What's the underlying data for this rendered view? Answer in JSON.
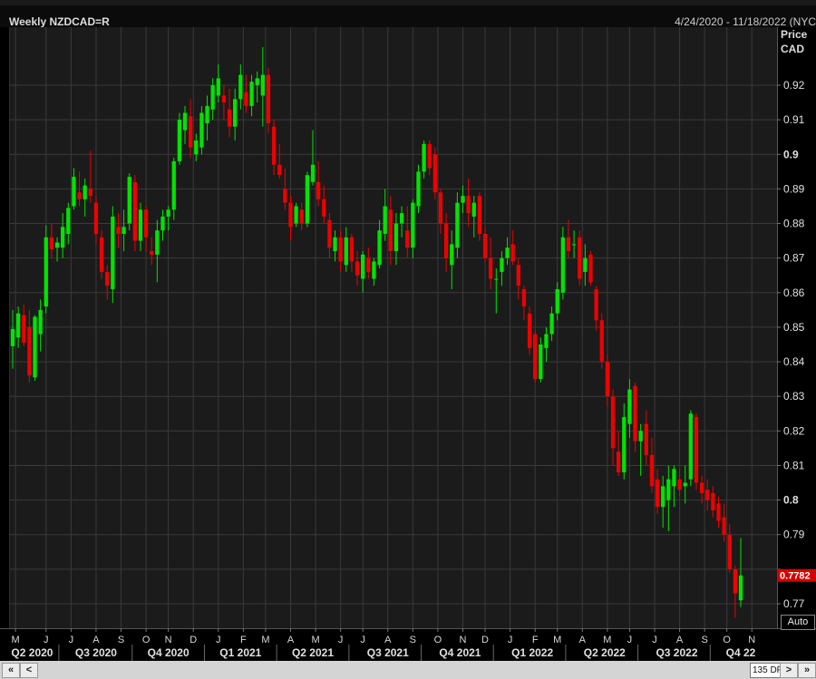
{
  "header": {
    "title": "Weekly NZDCAD=R",
    "date_range": "4/24/2020 - 11/18/2022 (NYC"
  },
  "axis": {
    "ylabel_line1": "Price",
    "ylabel_line2": "CAD",
    "auto_label": "Auto",
    "last_price_label": "0.7782"
  },
  "scrollbar": {
    "left_double": "«",
    "left_single": "<",
    "dp_label": "135 DP",
    "right_single": ">",
    "right_double": "»"
  },
  "colors": {
    "up": "#00e400",
    "down": "#ee0000",
    "bg": "#1b1b1b",
    "grid": "#3a3a3a",
    "price_tag": "#d40000"
  },
  "chart_data": {
    "type": "candlestick",
    "title": "Weekly NZDCAD=R",
    "ylabel": "Price CAD",
    "ylim": [
      0.766,
      0.934
    ],
    "y_ticks": [
      0.77,
      0.78,
      0.79,
      0.8,
      0.81,
      0.82,
      0.83,
      0.84,
      0.85,
      0.86,
      0.87,
      0.88,
      0.89,
      0.9,
      0.91,
      0.92
    ],
    "y_tick_labels": [
      "0.77",
      "",
      "0.79",
      "0.8",
      "0.81",
      "0.82",
      "0.83",
      "0.84",
      "0.85",
      "0.86",
      "0.87",
      "0.88",
      "0.89",
      "0.9",
      "0.91",
      "0.92"
    ],
    "bold_ticks": [
      0.8,
      0.9
    ],
    "month_labels": [
      {
        "label": "M",
        "week": 0.5
      },
      {
        "label": "J",
        "week": 6
      },
      {
        "label": "J",
        "week": 10.5
      },
      {
        "label": "A",
        "week": 15
      },
      {
        "label": "S",
        "week": 19.5
      },
      {
        "label": "O",
        "week": 24
      },
      {
        "label": "N",
        "week": 28
      },
      {
        "label": "D",
        "week": 32.5
      },
      {
        "label": "J",
        "week": 37
      },
      {
        "label": "F",
        "week": 41.5
      },
      {
        "label": "M",
        "week": 45.5
      },
      {
        "label": "A",
        "week": 50
      },
      {
        "label": "M",
        "week": 54.5
      },
      {
        "label": "J",
        "week": 59
      },
      {
        "label": "J",
        "week": 63
      },
      {
        "label": "A",
        "week": 67.5
      },
      {
        "label": "S",
        "week": 72
      },
      {
        "label": "O",
        "week": 76.5
      },
      {
        "label": "N",
        "week": 81
      },
      {
        "label": "D",
        "week": 85
      },
      {
        "label": "J",
        "week": 89.5
      },
      {
        "label": "F",
        "week": 94
      },
      {
        "label": "M",
        "week": 98
      },
      {
        "label": "A",
        "week": 102.5
      },
      {
        "label": "M",
        "week": 107
      },
      {
        "label": "J",
        "week": 111
      },
      {
        "label": "J",
        "week": 115.5
      },
      {
        "label": "A",
        "week": 120
      },
      {
        "label": "S",
        "week": 124.5
      },
      {
        "label": "O",
        "week": 128.5
      },
      {
        "label": "N",
        "week": 133
      }
    ],
    "quarter_labels": [
      {
        "label": "Q2 2020",
        "week": 3.5
      },
      {
        "label": "Q3 2020",
        "week": 15
      },
      {
        "label": "Q4 2020",
        "week": 28
      },
      {
        "label": "Q1 2021",
        "week": 41
      },
      {
        "label": "Q2 2021",
        "week": 54
      },
      {
        "label": "Q3 2021",
        "week": 67.5
      },
      {
        "label": "Q4 2021",
        "week": 80.5
      },
      {
        "label": "Q1 2022",
        "week": 93.5
      },
      {
        "label": "Q2 2022",
        "week": 106.5
      },
      {
        "label": "Q3 2022",
        "week": 119.5
      },
      {
        "label": "Q4 22",
        "week": 131
      }
    ],
    "quarter_separators": [
      8.3,
      21.5,
      34.5,
      47.5,
      60.5,
      73.5,
      86.5,
      99.5,
      112.5,
      125.5
    ],
    "last_price": 0.7782,
    "candles": [
      {
        "o": 0.8445,
        "h": 0.855,
        "l": 0.838,
        "c": 0.8495
      },
      {
        "o": 0.847,
        "h": 0.856,
        "l": 0.844,
        "c": 0.854
      },
      {
        "o": 0.8535,
        "h": 0.8565,
        "l": 0.8445,
        "c": 0.8455
      },
      {
        "o": 0.85,
        "h": 0.855,
        "l": 0.834,
        "c": 0.836
      },
      {
        "o": 0.8355,
        "h": 0.8535,
        "l": 0.8345,
        "c": 0.853
      },
      {
        "o": 0.848,
        "h": 0.858,
        "l": 0.843,
        "c": 0.855
      },
      {
        "o": 0.856,
        "h": 0.8795,
        "l": 0.854,
        "c": 0.876
      },
      {
        "o": 0.876,
        "h": 0.88,
        "l": 0.87,
        "c": 0.8725
      },
      {
        "o": 0.873,
        "h": 0.876,
        "l": 0.869,
        "c": 0.8745
      },
      {
        "o": 0.873,
        "h": 0.883,
        "l": 0.87,
        "c": 0.879
      },
      {
        "o": 0.877,
        "h": 0.886,
        "l": 0.874,
        "c": 0.8845
      },
      {
        "o": 0.885,
        "h": 0.896,
        "l": 0.884,
        "c": 0.8935
      },
      {
        "o": 0.889,
        "h": 0.895,
        "l": 0.885,
        "c": 0.887
      },
      {
        "o": 0.887,
        "h": 0.893,
        "l": 0.882,
        "c": 0.891
      },
      {
        "o": 0.89,
        "h": 0.901,
        "l": 0.886,
        "c": 0.888
      },
      {
        "o": 0.886,
        "h": 0.888,
        "l": 0.874,
        "c": 0.877
      },
      {
        "o": 0.876,
        "h": 0.878,
        "l": 0.864,
        "c": 0.866
      },
      {
        "o": 0.866,
        "h": 0.868,
        "l": 0.858,
        "c": 0.862
      },
      {
        "o": 0.861,
        "h": 0.885,
        "l": 0.857,
        "c": 0.882
      },
      {
        "o": 0.879,
        "h": 0.883,
        "l": 0.873,
        "c": 0.877
      },
      {
        "o": 0.877,
        "h": 0.884,
        "l": 0.872,
        "c": 0.879
      },
      {
        "o": 0.88,
        "h": 0.8945,
        "l": 0.878,
        "c": 0.8935
      },
      {
        "o": 0.892,
        "h": 0.894,
        "l": 0.872,
        "c": 0.875
      },
      {
        "o": 0.875,
        "h": 0.886,
        "l": 0.872,
        "c": 0.884
      },
      {
        "o": 0.884,
        "h": 0.885,
        "l": 0.872,
        "c": 0.876
      },
      {
        "o": 0.872,
        "h": 0.876,
        "l": 0.868,
        "c": 0.871
      },
      {
        "o": 0.871,
        "h": 0.881,
        "l": 0.863,
        "c": 0.878
      },
      {
        "o": 0.878,
        "h": 0.884,
        "l": 0.875,
        "c": 0.882
      },
      {
        "o": 0.882,
        "h": 0.885,
        "l": 0.878,
        "c": 0.884
      },
      {
        "o": 0.884,
        "h": 0.899,
        "l": 0.881,
        "c": 0.898
      },
      {
        "o": 0.898,
        "h": 0.912,
        "l": 0.897,
        "c": 0.91
      },
      {
        "o": 0.907,
        "h": 0.914,
        "l": 0.903,
        "c": 0.912
      },
      {
        "o": 0.911,
        "h": 0.916,
        "l": 0.899,
        "c": 0.902
      },
      {
        "o": 0.9,
        "h": 0.906,
        "l": 0.898,
        "c": 0.904
      },
      {
        "o": 0.902,
        "h": 0.914,
        "l": 0.9,
        "c": 0.912
      },
      {
        "o": 0.909,
        "h": 0.917,
        "l": 0.904,
        "c": 0.914
      },
      {
        "o": 0.913,
        "h": 0.922,
        "l": 0.91,
        "c": 0.92
      },
      {
        "o": 0.917,
        "h": 0.926,
        "l": 0.915,
        "c": 0.922
      },
      {
        "o": 0.917,
        "h": 0.92,
        "l": 0.91,
        "c": 0.915
      },
      {
        "o": 0.913,
        "h": 0.919,
        "l": 0.905,
        "c": 0.908
      },
      {
        "o": 0.908,
        "h": 0.919,
        "l": 0.904,
        "c": 0.916
      },
      {
        "o": 0.916,
        "h": 0.926,
        "l": 0.913,
        "c": 0.923
      },
      {
        "o": 0.918,
        "h": 0.923,
        "l": 0.912,
        "c": 0.914
      },
      {
        "o": 0.914,
        "h": 0.923,
        "l": 0.911,
        "c": 0.921
      },
      {
        "o": 0.92,
        "h": 0.924,
        "l": 0.915,
        "c": 0.922
      },
      {
        "o": 0.917,
        "h": 0.931,
        "l": 0.908,
        "c": 0.923
      },
      {
        "o": 0.923,
        "h": 0.925,
        "l": 0.906,
        "c": 0.909
      },
      {
        "o": 0.908,
        "h": 0.91,
        "l": 0.894,
        "c": 0.897
      },
      {
        "o": 0.897,
        "h": 0.903,
        "l": 0.893,
        "c": 0.894
      },
      {
        "o": 0.89,
        "h": 0.896,
        "l": 0.884,
        "c": 0.886
      },
      {
        "o": 0.886,
        "h": 0.888,
        "l": 0.875,
        "c": 0.879
      },
      {
        "o": 0.88,
        "h": 0.886,
        "l": 0.879,
        "c": 0.885
      },
      {
        "o": 0.884,
        "h": 0.886,
        "l": 0.878,
        "c": 0.88
      },
      {
        "o": 0.88,
        "h": 0.895,
        "l": 0.879,
        "c": 0.894
      },
      {
        "o": 0.892,
        "h": 0.907,
        "l": 0.891,
        "c": 0.897
      },
      {
        "o": 0.892,
        "h": 0.898,
        "l": 0.885,
        "c": 0.887
      },
      {
        "o": 0.887,
        "h": 0.891,
        "l": 0.88,
        "c": 0.882
      },
      {
        "o": 0.881,
        "h": 0.883,
        "l": 0.87,
        "c": 0.873
      },
      {
        "o": 0.872,
        "h": 0.878,
        "l": 0.869,
        "c": 0.876
      },
      {
        "o": 0.876,
        "h": 0.878,
        "l": 0.866,
        "c": 0.869
      },
      {
        "o": 0.868,
        "h": 0.879,
        "l": 0.866,
        "c": 0.876
      },
      {
        "o": 0.876,
        "h": 0.877,
        "l": 0.866,
        "c": 0.869
      },
      {
        "o": 0.869,
        "h": 0.872,
        "l": 0.862,
        "c": 0.865
      },
      {
        "o": 0.864,
        "h": 0.872,
        "l": 0.86,
        "c": 0.871
      },
      {
        "o": 0.87,
        "h": 0.873,
        "l": 0.864,
        "c": 0.866
      },
      {
        "o": 0.864,
        "h": 0.87,
        "l": 0.862,
        "c": 0.869
      },
      {
        "o": 0.868,
        "h": 0.881,
        "l": 0.867,
        "c": 0.878
      },
      {
        "o": 0.877,
        "h": 0.89,
        "l": 0.875,
        "c": 0.885
      },
      {
        "o": 0.884,
        "h": 0.888,
        "l": 0.868,
        "c": 0.872
      },
      {
        "o": 0.872,
        "h": 0.883,
        "l": 0.868,
        "c": 0.88
      },
      {
        "o": 0.88,
        "h": 0.885,
        "l": 0.876,
        "c": 0.883
      },
      {
        "o": 0.878,
        "h": 0.885,
        "l": 0.87,
        "c": 0.873
      },
      {
        "o": 0.873,
        "h": 0.887,
        "l": 0.87,
        "c": 0.886
      },
      {
        "o": 0.885,
        "h": 0.897,
        "l": 0.883,
        "c": 0.895
      },
      {
        "o": 0.895,
        "h": 0.904,
        "l": 0.893,
        "c": 0.903
      },
      {
        "o": 0.903,
        "h": 0.904,
        "l": 0.894,
        "c": 0.896
      },
      {
        "o": 0.9,
        "h": 0.902,
        "l": 0.887,
        "c": 0.889
      },
      {
        "o": 0.889,
        "h": 0.89,
        "l": 0.877,
        "c": 0.88
      },
      {
        "o": 0.88,
        "h": 0.883,
        "l": 0.866,
        "c": 0.87
      },
      {
        "o": 0.868,
        "h": 0.878,
        "l": 0.861,
        "c": 0.874
      },
      {
        "o": 0.873,
        "h": 0.889,
        "l": 0.87,
        "c": 0.886
      },
      {
        "o": 0.886,
        "h": 0.891,
        "l": 0.883,
        "c": 0.888
      },
      {
        "o": 0.888,
        "h": 0.893,
        "l": 0.879,
        "c": 0.883
      },
      {
        "o": 0.882,
        "h": 0.888,
        "l": 0.876,
        "c": 0.886
      },
      {
        "o": 0.888,
        "h": 0.889,
        "l": 0.875,
        "c": 0.877
      },
      {
        "o": 0.877,
        "h": 0.879,
        "l": 0.869,
        "c": 0.87
      },
      {
        "o": 0.87,
        "h": 0.876,
        "l": 0.861,
        "c": 0.864
      },
      {
        "o": 0.864,
        "h": 0.867,
        "l": 0.854,
        "c": 0.864
      },
      {
        "o": 0.866,
        "h": 0.872,
        "l": 0.862,
        "c": 0.87
      },
      {
        "o": 0.87,
        "h": 0.876,
        "l": 0.868,
        "c": 0.873
      },
      {
        "o": 0.874,
        "h": 0.878,
        "l": 0.868,
        "c": 0.869
      },
      {
        "o": 0.868,
        "h": 0.87,
        "l": 0.858,
        "c": 0.862
      },
      {
        "o": 0.861,
        "h": 0.862,
        "l": 0.852,
        "c": 0.856
      },
      {
        "o": 0.854,
        "h": 0.856,
        "l": 0.842,
        "c": 0.844
      },
      {
        "o": 0.848,
        "h": 0.849,
        "l": 0.834,
        "c": 0.835
      },
      {
        "o": 0.835,
        "h": 0.847,
        "l": 0.834,
        "c": 0.845
      },
      {
        "o": 0.844,
        "h": 0.85,
        "l": 0.84,
        "c": 0.848
      },
      {
        "o": 0.848,
        "h": 0.856,
        "l": 0.846,
        "c": 0.854
      },
      {
        "o": 0.854,
        "h": 0.863,
        "l": 0.852,
        "c": 0.861
      },
      {
        "o": 0.86,
        "h": 0.879,
        "l": 0.858,
        "c": 0.876
      },
      {
        "o": 0.876,
        "h": 0.881,
        "l": 0.87,
        "c": 0.872
      },
      {
        "o": 0.874,
        "h": 0.878,
        "l": 0.87,
        "c": 0.874
      },
      {
        "o": 0.876,
        "h": 0.878,
        "l": 0.862,
        "c": 0.864
      },
      {
        "o": 0.866,
        "h": 0.874,
        "l": 0.862,
        "c": 0.87
      },
      {
        "o": 0.871,
        "h": 0.872,
        "l": 0.862,
        "c": 0.863
      },
      {
        "o": 0.861,
        "h": 0.862,
        "l": 0.849,
        "c": 0.852
      },
      {
        "o": 0.852,
        "h": 0.854,
        "l": 0.838,
        "c": 0.84
      },
      {
        "o": 0.84,
        "h": 0.842,
        "l": 0.827,
        "c": 0.83
      },
      {
        "o": 0.83,
        "h": 0.832,
        "l": 0.81,
        "c": 0.815
      },
      {
        "o": 0.814,
        "h": 0.82,
        "l": 0.807,
        "c": 0.808
      },
      {
        "o": 0.808,
        "h": 0.828,
        "l": 0.806,
        "c": 0.824
      },
      {
        "o": 0.822,
        "h": 0.835,
        "l": 0.818,
        "c": 0.832
      },
      {
        "o": 0.833,
        "h": 0.834,
        "l": 0.814,
        "c": 0.817
      },
      {
        "o": 0.817,
        "h": 0.822,
        "l": 0.807,
        "c": 0.82
      },
      {
        "o": 0.822,
        "h": 0.826,
        "l": 0.81,
        "c": 0.813
      },
      {
        "o": 0.813,
        "h": 0.818,
        "l": 0.802,
        "c": 0.804
      },
      {
        "o": 0.806,
        "h": 0.809,
        "l": 0.796,
        "c": 0.798
      },
      {
        "o": 0.798,
        "h": 0.807,
        "l": 0.792,
        "c": 0.804
      },
      {
        "o": 0.8,
        "h": 0.81,
        "l": 0.791,
        "c": 0.806
      },
      {
        "o": 0.804,
        "h": 0.81,
        "l": 0.798,
        "c": 0.809
      },
      {
        "o": 0.806,
        "h": 0.809,
        "l": 0.801,
        "c": 0.803
      },
      {
        "o": 0.804,
        "h": 0.81,
        "l": 0.799,
        "c": 0.805
      },
      {
        "o": 0.806,
        "h": 0.826,
        "l": 0.804,
        "c": 0.825
      },
      {
        "o": 0.824,
        "h": 0.825,
        "l": 0.803,
        "c": 0.805
      },
      {
        "o": 0.805,
        "h": 0.807,
        "l": 0.799,
        "c": 0.802
      },
      {
        "o": 0.803,
        "h": 0.806,
        "l": 0.797,
        "c": 0.8
      },
      {
        "o": 0.802,
        "h": 0.804,
        "l": 0.795,
        "c": 0.797
      },
      {
        "o": 0.799,
        "h": 0.801,
        "l": 0.792,
        "c": 0.794
      },
      {
        "o": 0.795,
        "h": 0.799,
        "l": 0.788,
        "c": 0.79
      },
      {
        "o": 0.79,
        "h": 0.793,
        "l": 0.779,
        "c": 0.78
      },
      {
        "o": 0.78,
        "h": 0.781,
        "l": 0.766,
        "c": 0.773
      },
      {
        "o": 0.771,
        "h": 0.789,
        "l": 0.769,
        "c": 0.7782
      }
    ]
  }
}
